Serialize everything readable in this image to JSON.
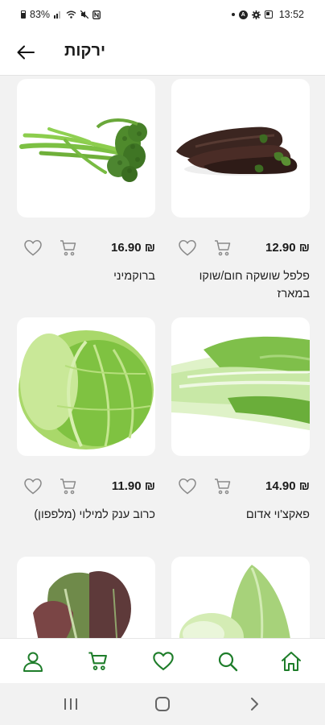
{
  "status_bar": {
    "battery_percent": "83%",
    "time": "13:52"
  },
  "header": {
    "title": "ירקות",
    "back_icon": "arrow-left-icon"
  },
  "products": [
    {
      "name": "פלפל שושקה חום/שוקו במארז",
      "price": "12.90 ₪",
      "image": "brown-peppers"
    },
    {
      "name": "ברוקמיני",
      "price": "16.90 ₪",
      "image": "broccolini"
    },
    {
      "name": "פאקצ'וי אדום",
      "price": "14.90 ₪",
      "image": "bok-choy"
    },
    {
      "name": "כרוב ענק למילוי (מלפפון)",
      "price": "11.90 ₪",
      "image": "green-cabbage"
    },
    {
      "name": "",
      "price": "",
      "image": "pointed-cabbage"
    },
    {
      "name": "",
      "price": "",
      "image": "red-lettuce"
    }
  ],
  "bottom_nav": {
    "items": [
      "home-icon",
      "search-icon",
      "heart-icon",
      "cart-icon",
      "user-icon"
    ],
    "accent": "#1e7d2a"
  },
  "system_nav": [
    "recents-icon",
    "home-circle-icon",
    "back-chevron-icon"
  ]
}
